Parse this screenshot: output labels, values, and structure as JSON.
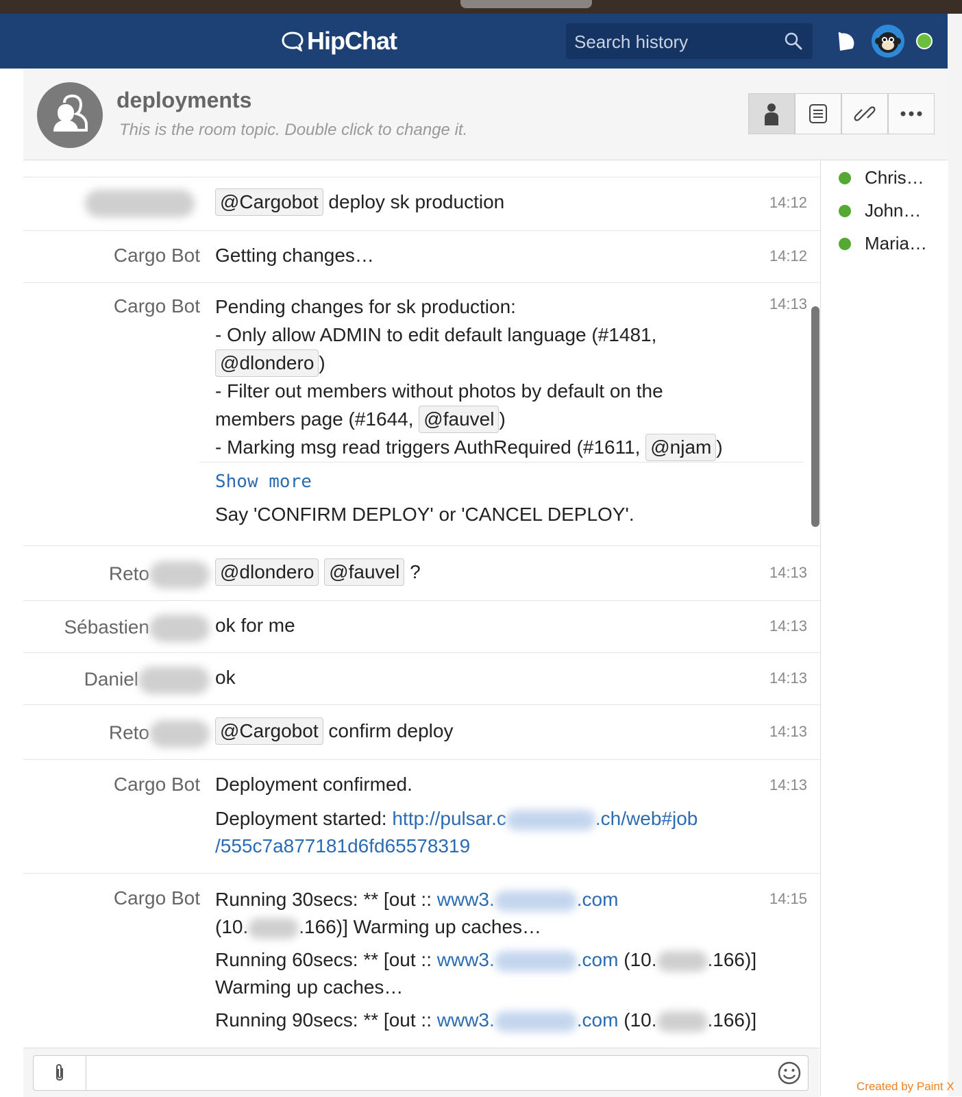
{
  "app": {
    "brand": "HipChat"
  },
  "search": {
    "placeholder": "Search history"
  },
  "room": {
    "name": "deployments",
    "topic": "This is the room topic. Double click to change it."
  },
  "messages": [
    {
      "sender": "",
      "time": "14:12",
      "mention": "@Cargobot",
      "text": "deploy sk production"
    },
    {
      "sender": "Cargo Bot",
      "time": "14:12",
      "text": "Getting changes…"
    },
    {
      "sender": "Cargo Bot",
      "time": "14:13",
      "line1": "Pending changes for sk production:",
      "line2": "- Only allow ADMIN to edit default language (#1481,",
      "mention_a": "@dlondero",
      "line3": "- Filter out members without photos by default on the",
      "line4": "members page (#1644,",
      "mention_b": "@fauvel",
      "line5": "- Marking msg read triggers AuthRequired (#1611,",
      "mention_c": "@njam",
      "show_more": "Show more",
      "confirm_text": "Say 'CONFIRM DEPLOY' or 'CANCEL DEPLOY'."
    },
    {
      "sender": "Reto",
      "time": "14:13",
      "mention_a": "@dlondero",
      "mention_b": "@fauvel",
      "text": "?"
    },
    {
      "sender": "Sébastien",
      "time": "14:13",
      "text": "ok for me"
    },
    {
      "sender": "Daniel",
      "time": "14:13",
      "text": "ok"
    },
    {
      "sender": "Reto",
      "time": "14:13",
      "mention": "@Cargobot",
      "text": "confirm deploy"
    },
    {
      "sender": "Cargo Bot",
      "time": "14:13",
      "line1": "Deployment confirmed.",
      "line2_prefix": "Deployment started:",
      "link_a": "http://pulsar.c",
      "link_b": ".ch/web#job",
      "link_c": "/555c7a877181d6fd65578319"
    },
    {
      "sender": "Cargo Bot",
      "time": "14:15",
      "r1_prefix": "Running 30secs:  ** [out ::",
      "r1_link_a": "www3.",
      "r1_link_b": ".com",
      "r1_l2_a": "(10.",
      "r1_l2_b": ".166)] Warming up caches…",
      "r2_prefix": "Running 60secs:  ** [out ::",
      "r2_link_a": "www3.",
      "r2_link_b": ".com",
      "r2_mid": "(10.",
      "r2_end": ".166)]",
      "r2_l2": "Warming up caches…",
      "r3_prefix": "Running 90secs:  ** [out ::",
      "r3_link_a": "www3.",
      "r3_link_b": ".com",
      "r3_mid": "(10.",
      "r3_end": ".166)]"
    }
  ],
  "roster": [
    "Chris…",
    "John…",
    "Maria…"
  ],
  "credit": "Created by Paint X",
  "colors": {
    "header": "#1e4175",
    "online": "#55a832",
    "link": "#2a6bb2"
  }
}
